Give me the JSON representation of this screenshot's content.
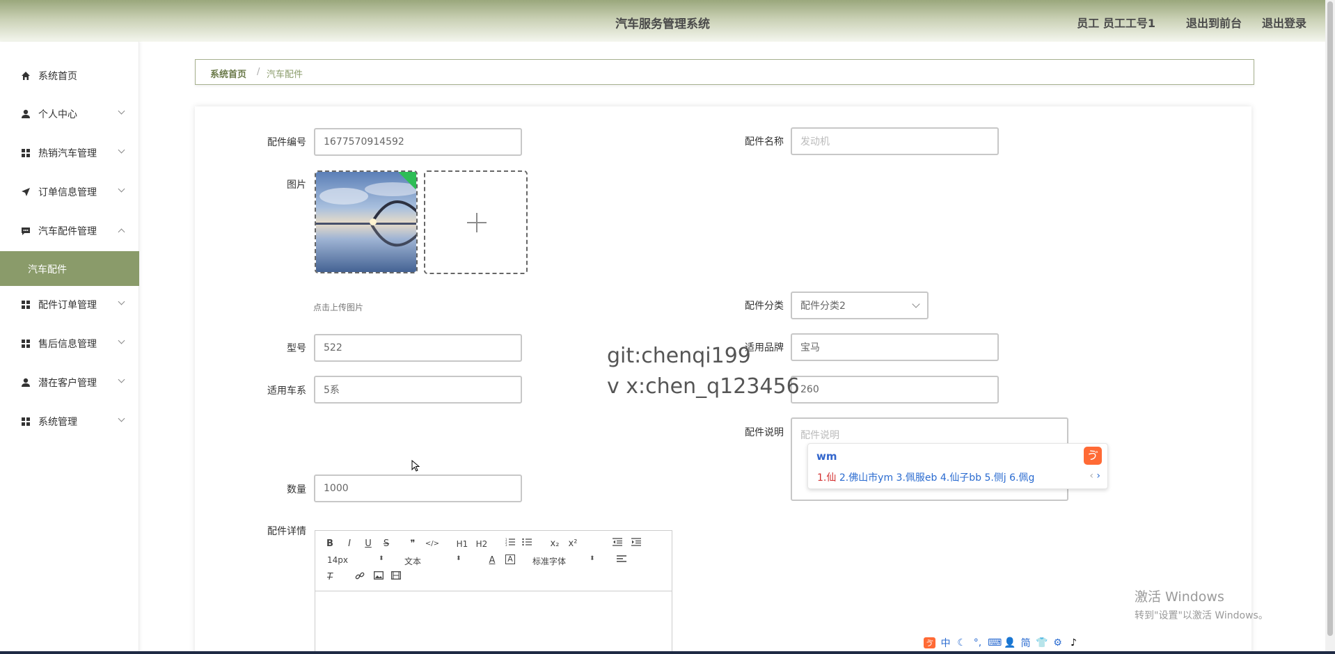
{
  "header": {
    "title": "汽车服务管理系统",
    "user": "员工 员工工号1",
    "front_link": "退出到前台",
    "logout_link": "退出登录"
  },
  "sidebar": {
    "items": [
      {
        "label": "系统首页",
        "icon": "home-icon"
      },
      {
        "label": "个人中心",
        "icon": "user-icon"
      },
      {
        "label": "热销汽车管理",
        "icon": "grid-icon"
      },
      {
        "label": "订单信息管理",
        "icon": "send-icon"
      },
      {
        "label": "汽车配件管理",
        "icon": "chat-icon"
      },
      {
        "label": "配件订单管理",
        "icon": "grid-icon"
      },
      {
        "label": "售后信息管理",
        "icon": "grid-icon"
      },
      {
        "label": "潜在客户管理",
        "icon": "user-icon"
      },
      {
        "label": "系统管理",
        "icon": "grid-icon"
      }
    ],
    "active_sub": "汽车配件"
  },
  "breadcrumb": {
    "home": "系统首页",
    "separator": "/",
    "current": "汽车配件"
  },
  "form": {
    "part_no_label": "配件编号",
    "part_no": "1677570914592",
    "part_name_label": "配件名称",
    "part_name_placeholder": "发动机",
    "image_label": "图片",
    "upload_tip": "点击上传图片",
    "category_label": "配件分类",
    "category": "配件分类2",
    "model_label": "型号",
    "model": "522",
    "brand_label": "适用品牌",
    "brand": "宝马",
    "series_label": "适用车系",
    "series": "5系",
    "price": "260",
    "desc_label": "配件说明",
    "desc_placeholder": "配件说明",
    "qty_label": "数量",
    "qty": "1000",
    "detail_label": "配件详情"
  },
  "editor": {
    "font_size": "14px",
    "text_type": "文本",
    "font_family": "标准字体",
    "buttons": [
      "B",
      "I",
      "U",
      "S",
      "❞",
      "</>",
      "H1",
      "H2",
      "ol",
      "ul",
      "x₂",
      "x²",
      "outdent",
      "indent"
    ]
  },
  "watermark": {
    "line1": "git:chenqi199",
    "line2": "v x:chen_q123456"
  },
  "ime": {
    "pinyin": "wm",
    "candidates": [
      {
        "text": "1.仙"
      },
      {
        "text": "2.佛山市ym"
      },
      {
        "text": "3.佩服eb"
      },
      {
        "text": "4.仙子bb"
      },
      {
        "text": "5.侧j"
      },
      {
        "text": "6.佩g"
      }
    ]
  },
  "activate": {
    "line1": "激活 Windows",
    "line2": "转到\"设置\"以激活 Windows。"
  },
  "tray": {
    "items": [
      "中",
      "简"
    ]
  }
}
